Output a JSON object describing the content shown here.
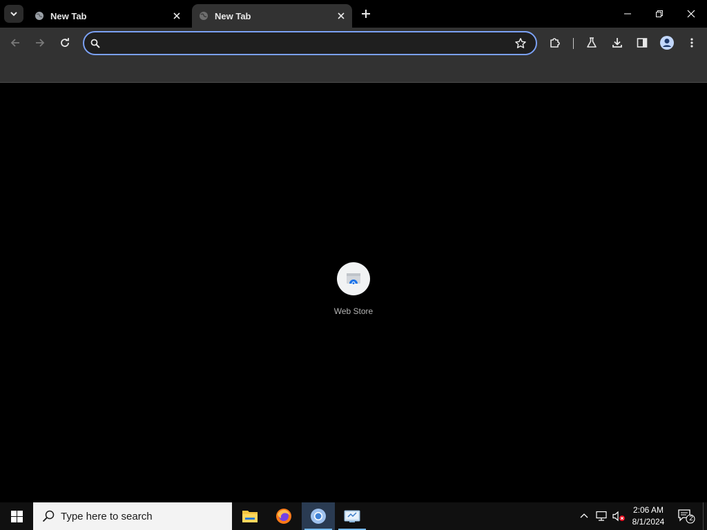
{
  "browser": {
    "tabs": [
      {
        "title": "New Tab",
        "active": false
      },
      {
        "title": "New Tab",
        "active": true
      }
    ],
    "omnibox": {
      "value": "",
      "placeholder": ""
    },
    "accent_color": "#7ba1f5"
  },
  "new_tab_page": {
    "shortcuts": [
      {
        "label": "Web Store",
        "icon": "web-store-icon"
      }
    ]
  },
  "taskbar": {
    "search_placeholder": "Type here to search",
    "apps": [
      {
        "name": "file-explorer",
        "icon": "folder-icon"
      },
      {
        "name": "firefox",
        "icon": "firefox-icon"
      },
      {
        "name": "chrome",
        "icon": "chrome-icon",
        "active": true
      },
      {
        "name": "control-panel",
        "icon": "control-panel-icon"
      }
    ],
    "clock": {
      "time": "2:06 AM",
      "date": "8/1/2024"
    },
    "notification_count": "2"
  }
}
